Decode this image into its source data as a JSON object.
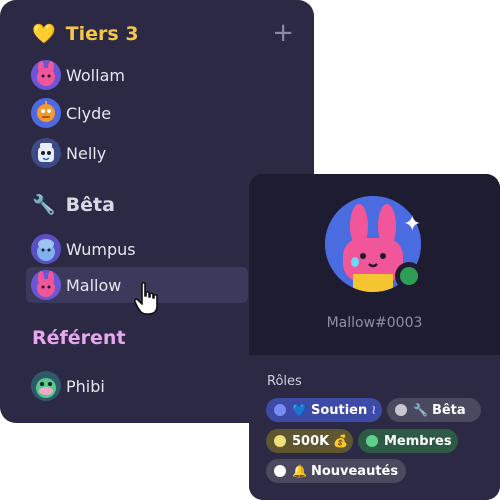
{
  "sidebar": {
    "add_label": "+",
    "sections": [
      {
        "title": "Tiers 3",
        "emoji": "💛",
        "title_color": "#f4c64a",
        "members": [
          "Wollam",
          "Clyde",
          "Nelly"
        ]
      },
      {
        "title": "Bêta",
        "emoji": "🔧",
        "title_color": "#d9d9e6",
        "members": [
          "Wumpus",
          "Mallow"
        ]
      },
      {
        "title": "Référent",
        "emoji": "",
        "title_color": "#e9a6f0",
        "members": [
          "Phibi"
        ]
      }
    ],
    "selected_member": "Mallow"
  },
  "profile": {
    "username": "Mallow#0003",
    "status": "online",
    "status_color": "#2e9e55",
    "roles_title": "Rôles",
    "roles": [
      {
        "label": "Soutien",
        "emoji": "💙",
        "dot_color": "#7b8cf0",
        "bg": "#3d4aa6",
        "suffix": "≀"
      },
      {
        "label": "Bêta",
        "emoji": "🔧",
        "dot_color": "#c7c7cf",
        "bg": "#4a4960",
        "suffix": ""
      },
      {
        "label": "500K",
        "emoji": "💰",
        "dot_color": "#f0e07a",
        "bg": "#5e5630",
        "suffix": ""
      },
      {
        "label": "Membres",
        "emoji": "",
        "dot_color": "#5fce8a",
        "bg": "#2d5a45",
        "suffix": ""
      },
      {
        "label": "Nouveautés",
        "emoji": "🔔",
        "dot_color": "#ffffff",
        "bg": "#4a4960",
        "suffix": ""
      }
    ]
  },
  "icons": [
    "plus-icon",
    "yellow-heart-icon",
    "wrench-icon",
    "sparkle-icon",
    "hand-cursor-icon"
  ]
}
